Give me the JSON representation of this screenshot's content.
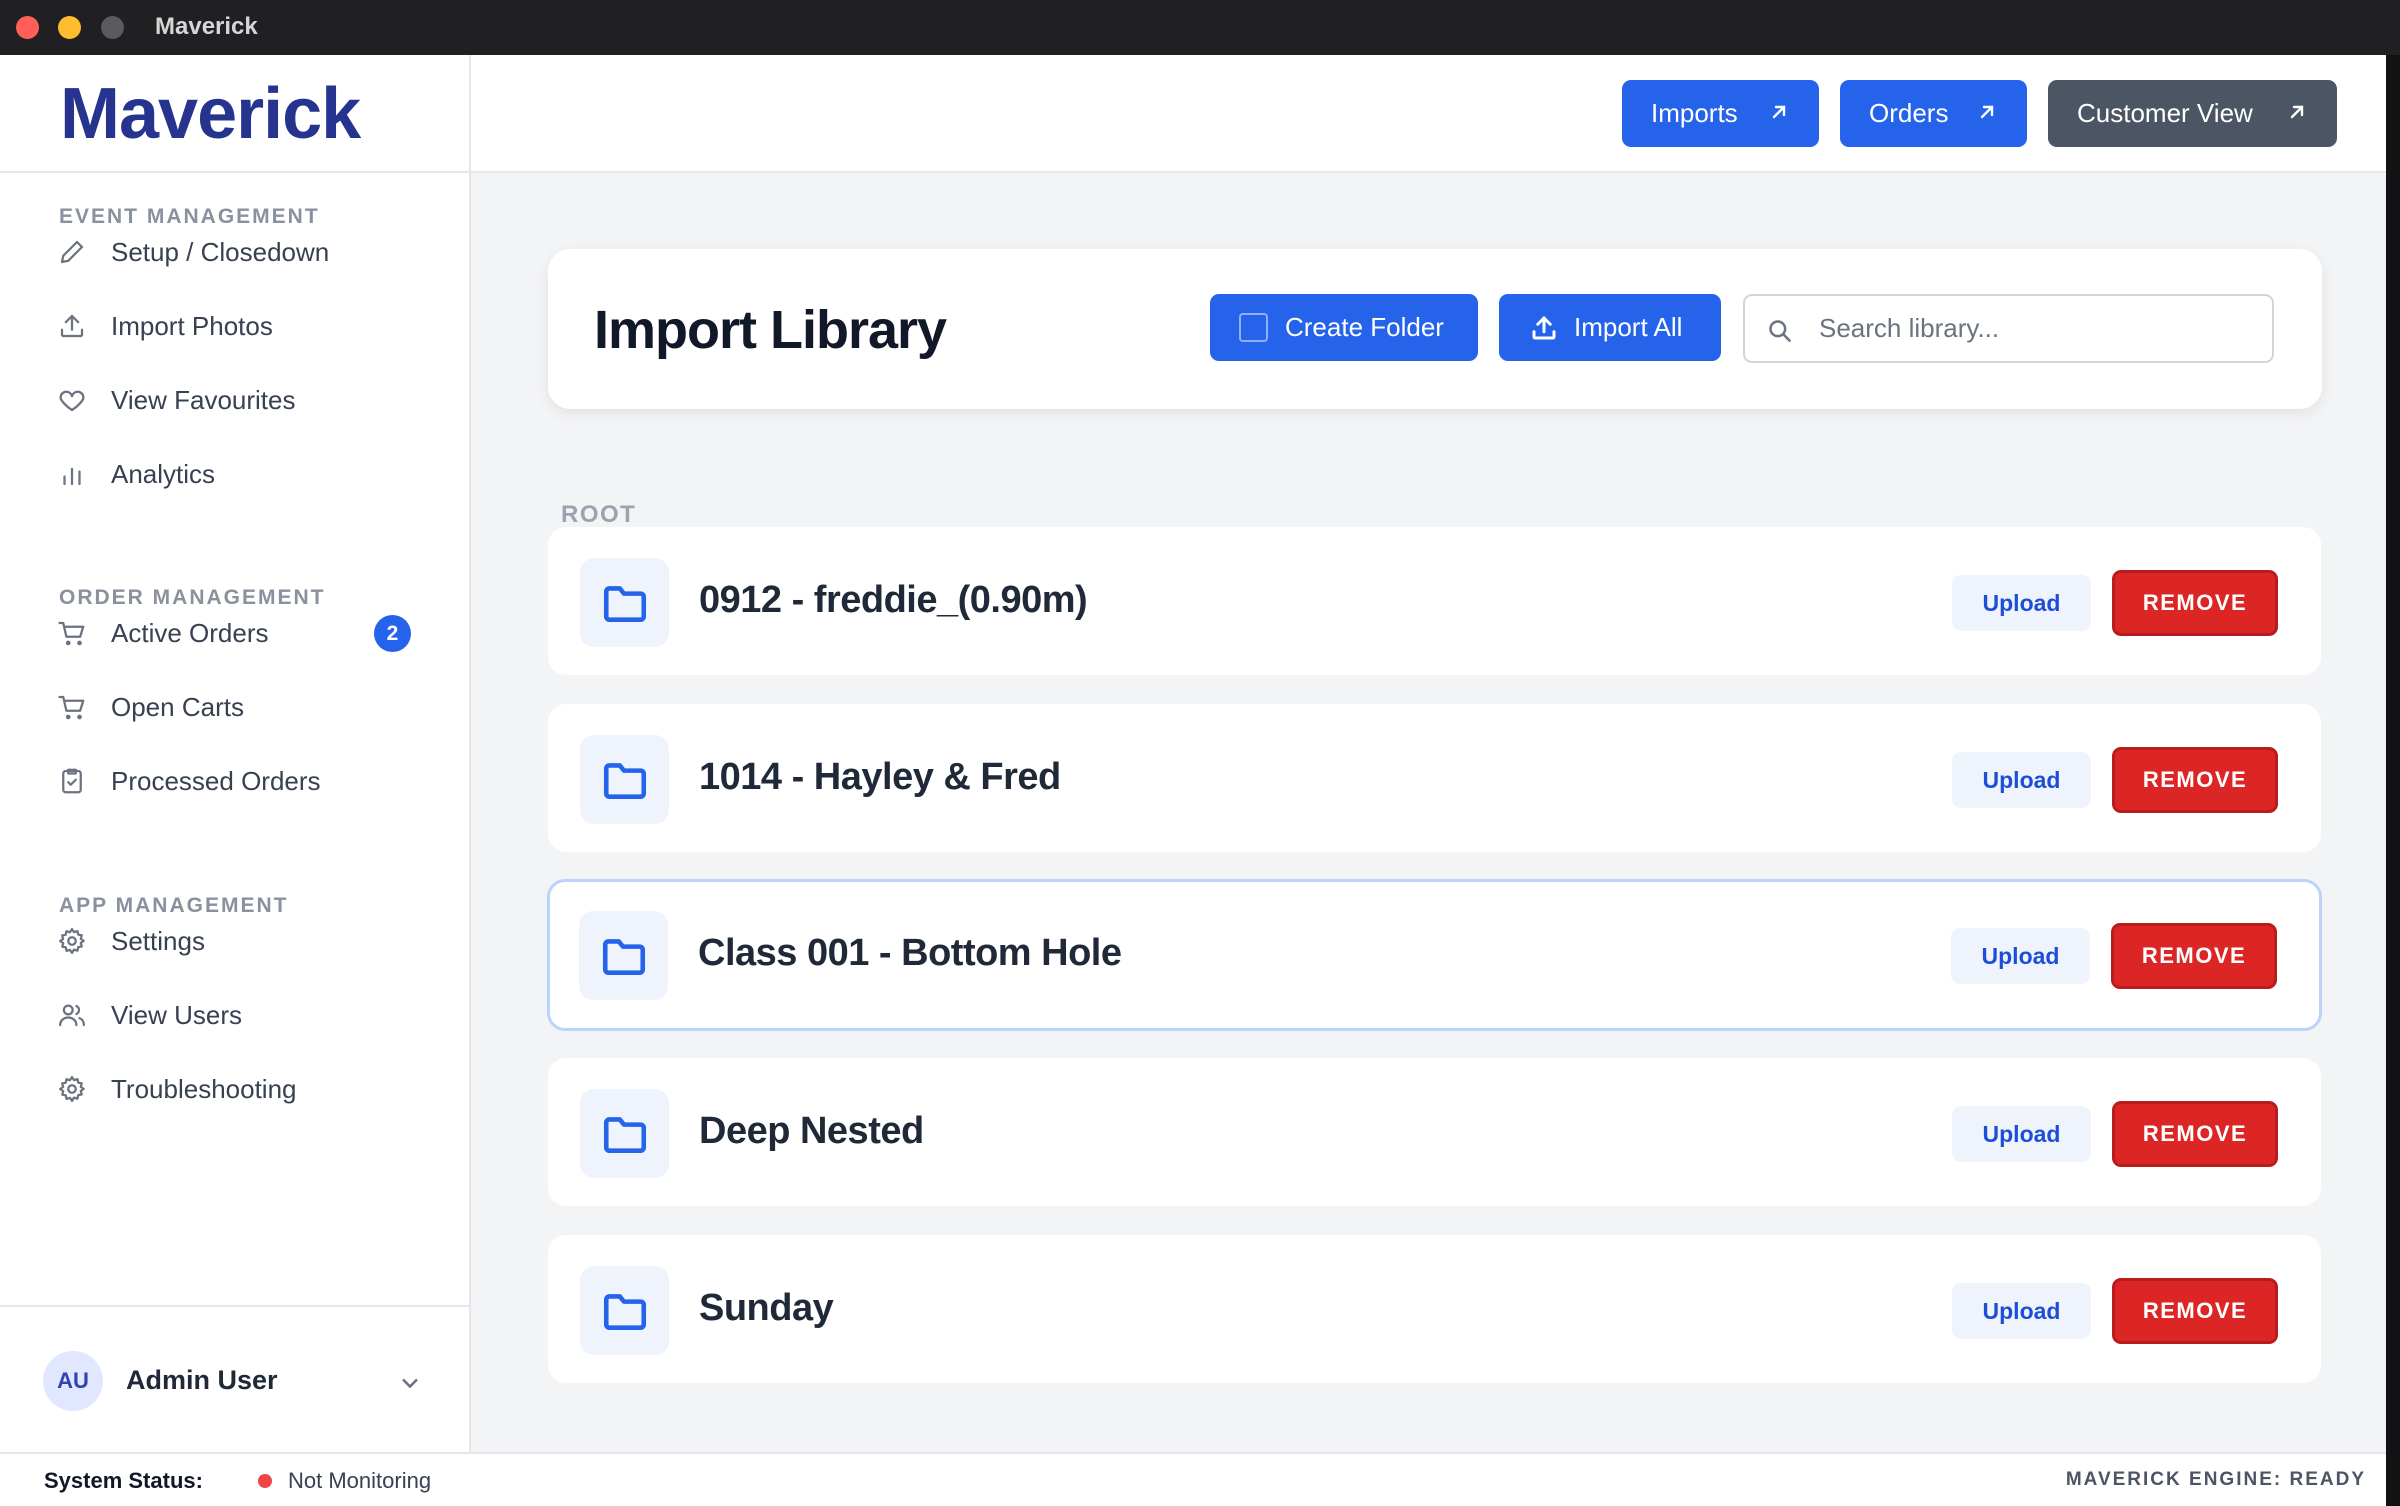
{
  "window": {
    "title": "Maverick"
  },
  "brand": {
    "name": "Maverick"
  },
  "header": {
    "buttons": [
      {
        "label": "Imports",
        "icon": "arrow-up-right-icon",
        "color": "#2563eb"
      },
      {
        "label": "Orders",
        "icon": "arrow-up-right-icon",
        "color": "#2563eb"
      },
      {
        "label": "Customer View",
        "icon": "arrow-up-right-icon",
        "color": "#4b5563"
      }
    ]
  },
  "sidebar": {
    "sections": [
      {
        "title": "EVENT MANAGEMENT",
        "items": [
          {
            "label": "Setup / Closedown",
            "icon": "pencil-icon"
          },
          {
            "label": "Import Photos",
            "icon": "upload-icon"
          },
          {
            "label": "View Favourites",
            "icon": "heart-icon"
          },
          {
            "label": "Analytics",
            "icon": "bar-chart-icon"
          }
        ]
      },
      {
        "title": "ORDER MANAGEMENT",
        "items": [
          {
            "label": "Active Orders",
            "icon": "cart-icon",
            "badge": "2"
          },
          {
            "label": "Open Carts",
            "icon": "cart-icon"
          },
          {
            "label": "Processed Orders",
            "icon": "clipboard-check-icon"
          }
        ]
      },
      {
        "title": "APP MANAGEMENT",
        "items": [
          {
            "label": "Settings",
            "icon": "gear-icon"
          },
          {
            "label": "View Users",
            "icon": "users-icon"
          },
          {
            "label": "Troubleshooting",
            "icon": "gear-icon"
          }
        ]
      }
    ],
    "user": {
      "initials": "AU",
      "name": "Admin User"
    }
  },
  "library": {
    "title": "Import Library",
    "create_folder_label": "Create Folder",
    "import_all_label": "Import All",
    "search_placeholder": "Search library...",
    "breadcrumb": "ROOT",
    "folders": [
      {
        "name": "0912 - freddie_(0.90m)",
        "upload_label": "Upload",
        "remove_label": "REMOVE"
      },
      {
        "name": "1014 - Hayley & Fred",
        "upload_label": "Upload",
        "remove_label": "REMOVE"
      },
      {
        "name": "Class 001 - Bottom Hole",
        "upload_label": "Upload",
        "remove_label": "REMOVE"
      },
      {
        "name": "Deep Nested",
        "upload_label": "Upload",
        "remove_label": "REMOVE"
      },
      {
        "name": "Sunday",
        "upload_label": "Upload",
        "remove_label": "REMOVE"
      }
    ]
  },
  "status": {
    "label": "System Status:",
    "text": "Not Monitoring",
    "dot_color": "#ef4444",
    "engine": "MAVERICK ENGINE: READY"
  }
}
